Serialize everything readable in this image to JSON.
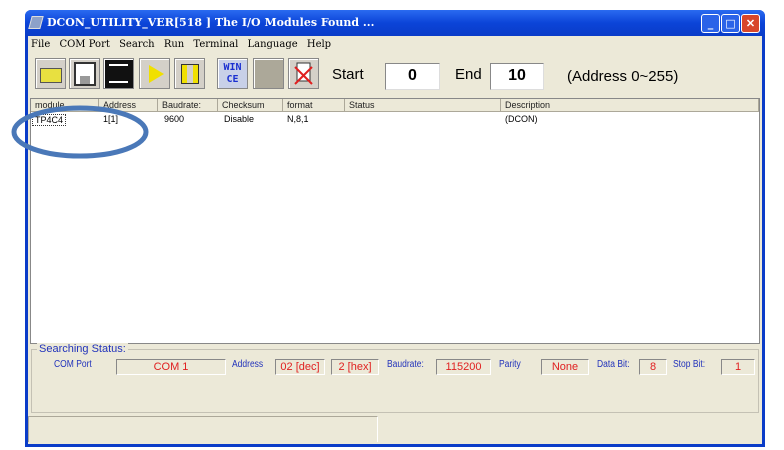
{
  "window": {
    "title": "DCON_UTILITY_VER[518  ] The I/O Modules Found ...",
    "minimize": "_",
    "maximize": "□",
    "close": "✕"
  },
  "menu": [
    "File",
    "COM Port",
    "Search",
    "Run",
    "Terminal",
    "Language",
    "Help"
  ],
  "toolbar": {
    "icons": [
      "open-folder-icon",
      "save-disk-icon",
      "printer-icon",
      "play-icon",
      "pause-icon",
      "wince-icon",
      "blank-icon",
      "disconnect-icon"
    ],
    "wince_label_1": "WIN",
    "wince_label_2": "CE",
    "start_label": "Start",
    "start_value": "0",
    "end_label": "End",
    "end_value": "10",
    "range_note": "(Address 0~255)"
  },
  "table": {
    "columns": [
      "module",
      "Address",
      "Baudrate:",
      "Checksum",
      "format",
      "Status",
      "Description"
    ],
    "rows": [
      [
        "TP4C4",
        "1[1]",
        "9600",
        "Disable",
        "N,8,1",
        "",
        "(DCON)"
      ]
    ]
  },
  "status": {
    "title": "Searching Status:",
    "com_port_label": "COM Port",
    "com_port": "COM 1",
    "address_label": "Address",
    "address_dec": "02 [dec]",
    "address_hex": "2 [hex]",
    "baudrate_label": "Baudrate:",
    "baudrate": "115200",
    "parity_label": "Parity",
    "parity": "None",
    "data_bit_label": "Data Bit:",
    "data_bit": "8",
    "stop_bit_label": "Stop Bit:",
    "stop_bit": "1"
  },
  "colors": {
    "annotation": "#4a78b8",
    "title_bar": "#0a3cc8",
    "value_text": "#e02020"
  }
}
